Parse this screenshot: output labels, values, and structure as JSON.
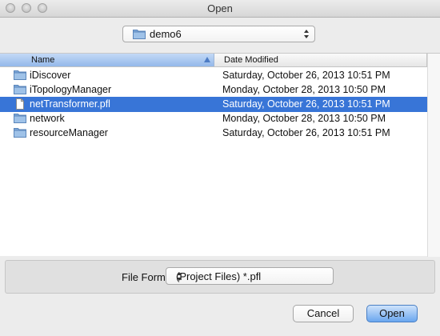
{
  "window": {
    "title": "Open"
  },
  "location": {
    "folder": "demo6"
  },
  "columns": {
    "name": "Name",
    "date": "Date Modified"
  },
  "files": [
    {
      "name": "iDiscover",
      "date": "Saturday, October 26, 2013 10:51 PM",
      "kind": "folder",
      "selected": false
    },
    {
      "name": "iTopologyManager",
      "date": "Monday, October 28, 2013 10:50 PM",
      "kind": "folder",
      "selected": false
    },
    {
      "name": "netTransformer.pfl",
      "date": "Saturday, October 26, 2013 10:51 PM",
      "kind": "file",
      "selected": true
    },
    {
      "name": "network",
      "date": "Monday, October 28, 2013 10:50 PM",
      "kind": "folder",
      "selected": false
    },
    {
      "name": "resourceManager",
      "date": "Saturday, October 26, 2013 10:51 PM",
      "kind": "folder",
      "selected": false
    }
  ],
  "format": {
    "label": "File Format:",
    "value": "(Project Files) *.pfl"
  },
  "buttons": {
    "cancel": "Cancel",
    "open": "Open"
  },
  "colors": {
    "selection": "#3875d7",
    "folder": "#7da8d9"
  }
}
